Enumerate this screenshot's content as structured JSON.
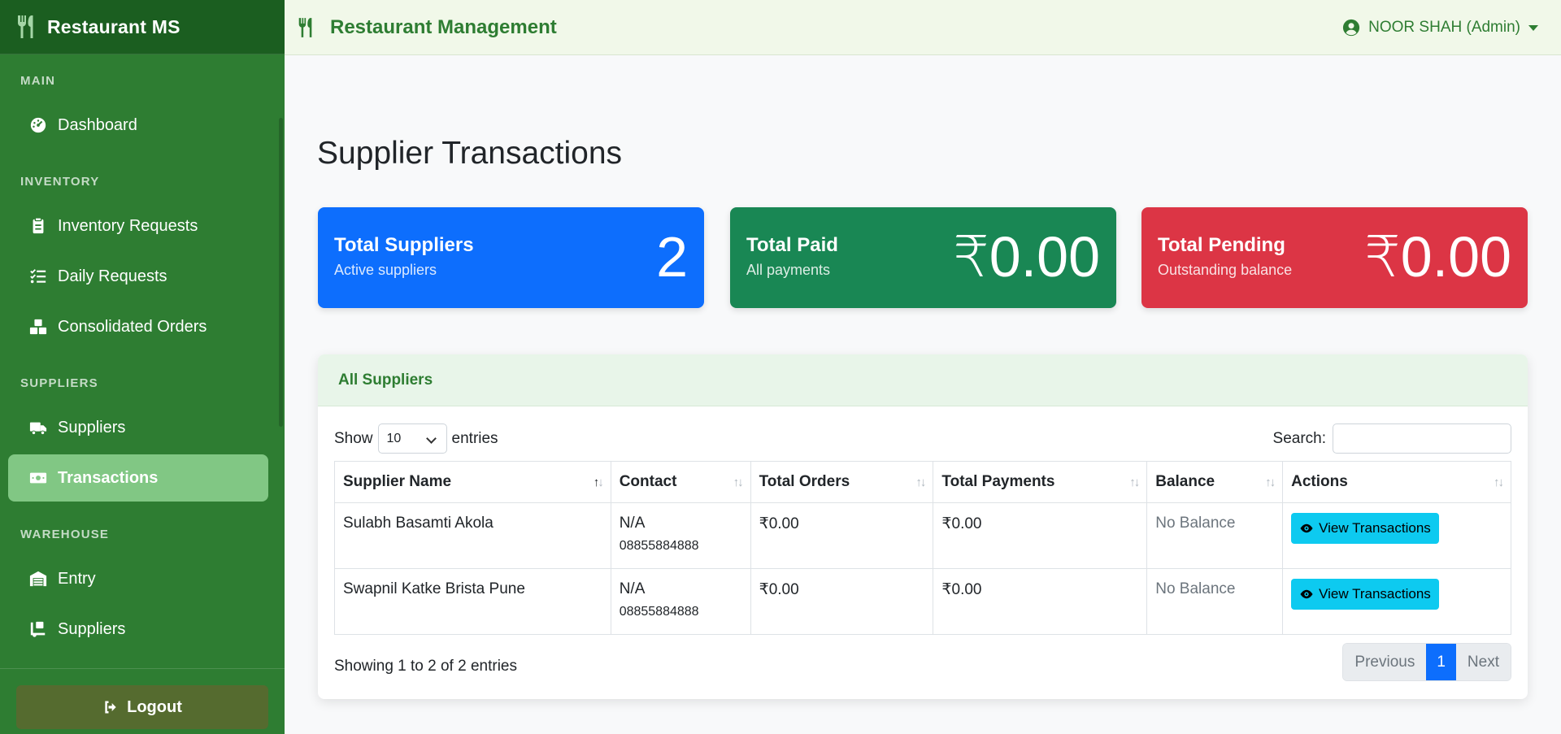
{
  "sidebar": {
    "brand": "Restaurant MS",
    "sections": {
      "main": "MAIN",
      "inventory": "INVENTORY",
      "suppliers": "SUPPLIERS",
      "warehouse": "WAREHOUSE"
    },
    "items": {
      "dashboard": "Dashboard",
      "inventory_requests": "Inventory Requests",
      "daily_requests": "Daily Requests",
      "consolidated_orders": "Consolidated Orders",
      "suppliers": "Suppliers",
      "transactions": "Transactions",
      "entry": "Entry",
      "warehouse_suppliers": "Suppliers"
    },
    "logout": "Logout"
  },
  "header": {
    "title": "Restaurant Management",
    "user": "NOOR SHAH (Admin)"
  },
  "page": {
    "title": "Supplier Transactions"
  },
  "stats": {
    "suppliers": {
      "label": "Total Suppliers",
      "sub": "Active suppliers",
      "value": "2"
    },
    "paid": {
      "label": "Total Paid",
      "sub": "All payments",
      "value": "₹0.00"
    },
    "pending": {
      "label": "Total Pending",
      "sub": "Outstanding balance",
      "value": "₹0.00"
    }
  },
  "table_card": {
    "title": "All Suppliers",
    "show": "Show",
    "entries_value": "10",
    "entries": "entries",
    "search_label": "Search:",
    "columns": [
      "Supplier Name",
      "Contact",
      "Total Orders",
      "Total Payments",
      "Balance",
      "Actions"
    ],
    "rows": [
      {
        "name": "Sulabh Basamti Akola",
        "contact": "N/A",
        "phone": "08855884888",
        "orders": "₹0.00",
        "payments": "₹0.00",
        "balance": "No Balance",
        "action": "View Transactions"
      },
      {
        "name": "Swapnil Katke Brista Pune",
        "contact": "N/A",
        "phone": "08855884888",
        "orders": "₹0.00",
        "payments": "₹0.00",
        "balance": "No Balance",
        "action": "View Transactions"
      }
    ],
    "info": "Showing 1 to 2 of 2 entries",
    "pager": {
      "prev": "Previous",
      "page": "1",
      "next": "Next"
    }
  },
  "colors": {
    "sidebar": "#2e7d32",
    "brand_bar": "#1b5e20",
    "active_item": "#81c784",
    "primary": "#0d6efd",
    "success": "#198754",
    "danger": "#dc3545",
    "info": "#0dcaf0"
  }
}
